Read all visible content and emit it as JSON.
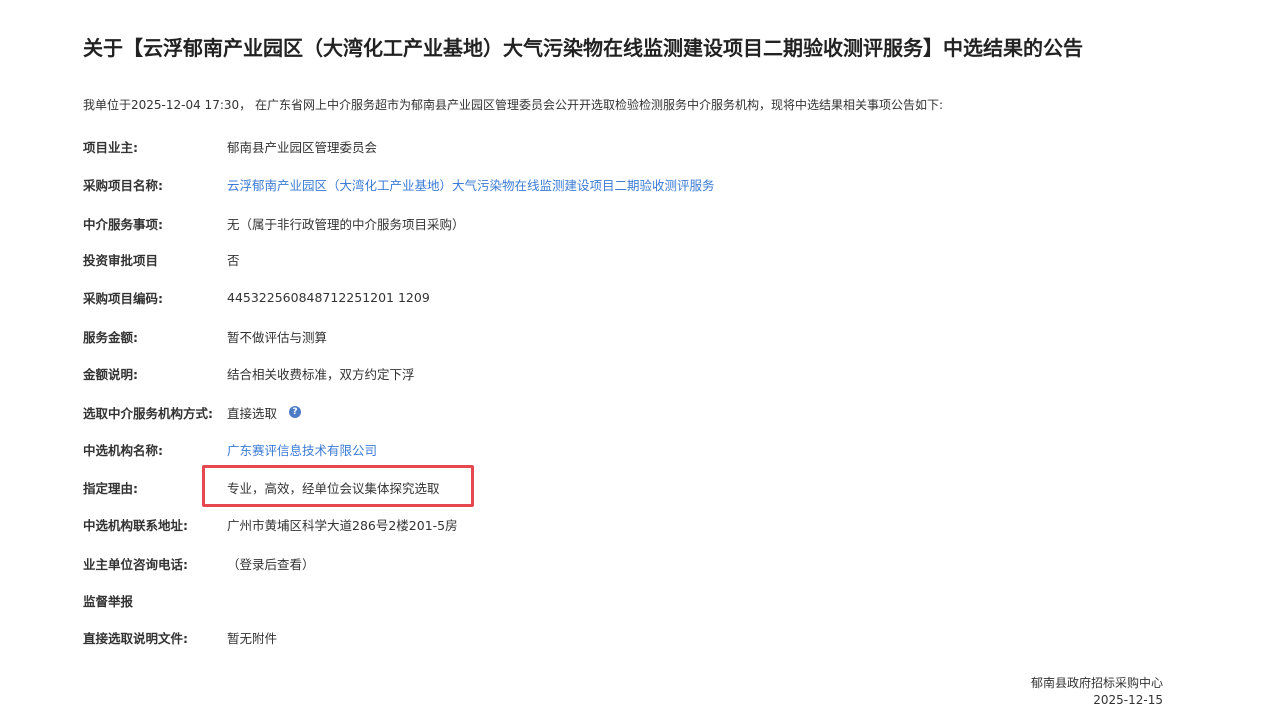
{
  "title": "关于【云浮郁南产业园区（大湾化工产业基地）大气污染物在线监测建设项目二期验收测评服务】中选结果的公告",
  "intro": "我单位于2025-12-04 17:30， 在广东省网上中介服务超市为郁南县产业园区管理委员会公开开选取检验检测服务中介服务机构，现将中选结果相关事项公告如下:",
  "fields": [
    {
      "label": "项目业主:",
      "value": "郁南县产业园区管理委员会"
    },
    {
      "label": "采购项目名称:",
      "value": "云浮郁南产业园区（大湾化工产业基地）大气污染物在线监测建设项目二期验收测评服务"
    },
    {
      "label": "中介服务事项:",
      "value": "无（属于非行政管理的中介服务项目采购）"
    },
    {
      "label": "投资审批项目",
      "value": "否"
    },
    {
      "label": "采购项目编码:",
      "value": "445322560848712251201 1209"
    },
    {
      "label": "服务金额:",
      "value": "暂不做评估与测算"
    },
    {
      "label": "金额说明:",
      "value": "结合相关收费标准，双方约定下浮"
    },
    {
      "label": "选取中介服务机构方式:",
      "value": "直接选取"
    },
    {
      "label": "中选机构名称:",
      "value": "广东赛评信息技术有限公司"
    },
    {
      "label": "指定理由:",
      "value": "专业，高效，经单位会议集体探究选取"
    },
    {
      "label": "中选机构联系地址:",
      "value": "广州市黄埔区科学大道286号2楼201-5房"
    },
    {
      "label": "业主单位咨询电话:",
      "value": "（登录后查看）"
    },
    {
      "label": "监督举报",
      "value": ""
    },
    {
      "label": "直接选取说明文件:",
      "value": "暂无附件"
    }
  ],
  "help_icon_glyph": "?",
  "footer": {
    "org": "郁南县政府招标采购中心",
    "date": "2025-12-15"
  },
  "colors": {
    "link": "#3b7bd6",
    "highlight": "#e5494f",
    "help_icon": "#4c7cc5"
  }
}
